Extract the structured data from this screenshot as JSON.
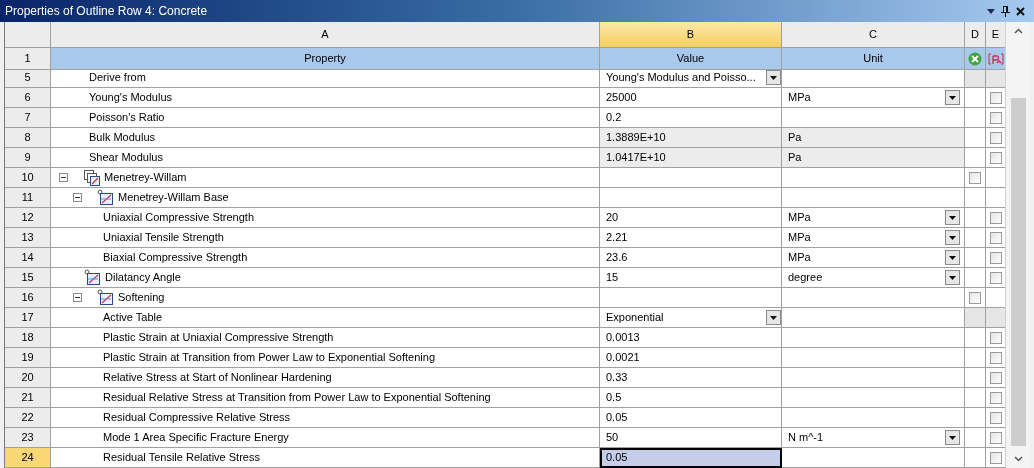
{
  "window": {
    "title": "Properties of Outline Row 4: Concrete"
  },
  "columns": [
    {
      "letter": "A",
      "selected": false
    },
    {
      "letter": "B",
      "selected": true
    },
    {
      "letter": "C",
      "selected": false
    },
    {
      "letter": "D",
      "selected": false
    },
    {
      "letter": "E",
      "selected": false
    }
  ],
  "header": {
    "num": "1",
    "property": "Property",
    "value": "Value",
    "unit": "Unit"
  },
  "rows": [
    {
      "num": "5",
      "kind": "property",
      "label": "Derive from",
      "value": "Young's Modulus and Poisso...",
      "value_dropdown": true,
      "locked": true,
      "selected": false
    },
    {
      "num": "6",
      "kind": "property",
      "label": "Young's Modulus",
      "value": "25000",
      "unit": "MPa",
      "unit_dropdown": true,
      "e_checked": false,
      "selected": false
    },
    {
      "num": "7",
      "kind": "property",
      "label": "Poisson's Ratio",
      "value": "0.2",
      "e_checked": false,
      "selected": false
    },
    {
      "num": "8",
      "kind": "property",
      "label": "Bulk Modulus",
      "value": "1.3889E+10",
      "unit": "Pa",
      "readonly": true,
      "e_checked": false,
      "selected": false
    },
    {
      "num": "9",
      "kind": "property",
      "label": "Shear Modulus",
      "value": "1.0417E+10",
      "unit": "Pa",
      "readonly": true,
      "e_checked": false,
      "selected": false
    },
    {
      "num": "10",
      "kind": "model_group",
      "label": "Menetrey-Willam",
      "expanded": true,
      "d_checked": false,
      "selected": false,
      "children": [
        {
          "num": "11",
          "kind": "curve_group",
          "label": "Menetrey-Willam Base",
          "expanded": true,
          "selected": false,
          "children": [
            {
              "num": "12",
              "kind": "property",
              "label": "Uniaxial Compressive Strength",
              "value": "20",
              "unit": "MPa",
              "unit_dropdown": true,
              "e_checked": false,
              "selected": false
            },
            {
              "num": "13",
              "kind": "property",
              "label": "Uniaxial Tensile Strength",
              "value": "2.21",
              "unit": "MPa",
              "unit_dropdown": true,
              "e_checked": false,
              "selected": false
            },
            {
              "num": "14",
              "kind": "property",
              "label": "Biaxial Compressive Strength",
              "value": "23.6",
              "unit": "MPa",
              "unit_dropdown": true,
              "e_checked": false,
              "selected": false
            }
          ]
        },
        {
          "num": "15",
          "kind": "curve_property",
          "label": "Dilatancy Angle",
          "value": "15",
          "unit": "degree",
          "unit_dropdown": true,
          "e_checked": false,
          "selected": false
        },
        {
          "num": "16",
          "kind": "curve_group",
          "label": "Softening",
          "expanded": true,
          "d_checked": false,
          "selected": false,
          "children": [
            {
              "num": "17",
              "kind": "property",
              "label": "Active Table",
              "value": "Exponential",
              "value_dropdown": true,
              "locked": true,
              "selected": false
            },
            {
              "num": "18",
              "kind": "property",
              "label": "Plastic Strain at Uniaxial Compressive Strength",
              "value": "0.0013",
              "e_checked": false,
              "selected": false
            },
            {
              "num": "19",
              "kind": "property",
              "label": "Plastic Strain at Transition from Power Law to Exponential Softening",
              "value": "0.0021",
              "e_checked": false,
              "selected": false
            },
            {
              "num": "20",
              "kind": "property",
              "label": "Relative Stress at Start of Nonlinear Hardening",
              "value": "0.33",
              "e_checked": false,
              "selected": false
            },
            {
              "num": "21",
              "kind": "property",
              "label": "Residual Relative Stress at Transition from Power Law to Exponential Softening",
              "value": "0.5",
              "e_checked": false,
              "selected": false
            },
            {
              "num": "22",
              "kind": "property",
              "label": "Residual Compressive Relative Stress",
              "value": "0.05",
              "e_checked": false,
              "selected": false
            },
            {
              "num": "23",
              "kind": "property",
              "label": "Mode 1 Area Specific Fracture Energy",
              "value": "50",
              "unit": "N m^-1",
              "unit_dropdown": true,
              "e_checked": false,
              "selected": false
            },
            {
              "num": "24",
              "kind": "property",
              "label": "Residual Tensile Relative Stress",
              "value": "0.05",
              "e_checked": false,
              "selected": true
            }
          ]
        }
      ]
    }
  ]
}
